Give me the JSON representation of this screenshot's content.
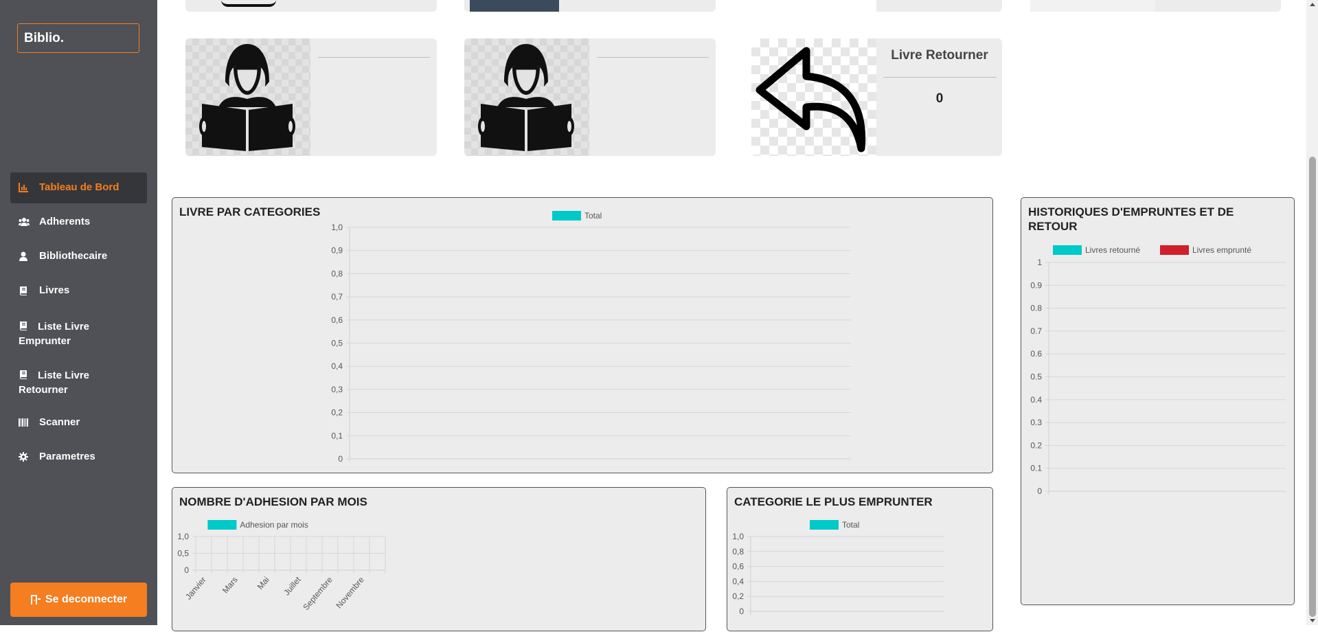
{
  "sidebar": {
    "brand": "Biblio.",
    "items": [
      {
        "label": "Tableau de Bord",
        "icon": "chart-icon",
        "active": true
      },
      {
        "label": "Adherents",
        "icon": "users-icon"
      },
      {
        "label": "Bibliothecaire",
        "icon": "user-icon"
      },
      {
        "label": "Livres",
        "icon": "book-icon"
      },
      {
        "label": "Liste Livre Emprunter",
        "icon": "book-icon"
      },
      {
        "label": "Liste Livre Retourner",
        "icon": "book-icon"
      },
      {
        "label": "Scanner",
        "icon": "barcode-icon"
      },
      {
        "label": "Parametres",
        "icon": "gear-icon"
      }
    ],
    "logout_label": "Se deconnecter"
  },
  "cards": {
    "returned_title": "Livre Retourner",
    "returned_value": "0"
  },
  "colors": {
    "accent": "#f47e20",
    "sidebar": "#4f5156",
    "teal": "#00c9c9",
    "red": "#d0202a"
  },
  "chart_data": [
    {
      "type": "bar",
      "title": "LIVRE PAR CATEGORIES",
      "categories": [],
      "series": [
        {
          "name": "Total",
          "values": []
        }
      ],
      "ylim": [
        0,
        1
      ],
      "yticks": [
        "1,0",
        "0,9",
        "0,8",
        "0,7",
        "0,6",
        "0,5",
        "0,4",
        "0,3",
        "0,2",
        "0,1",
        "0"
      ],
      "grid": true,
      "legend": "top"
    },
    {
      "type": "bar",
      "title": "HISTORIQUES D'EMPRUNTES ET DE RETOUR",
      "categories": [],
      "series": [
        {
          "name": "Livres retourné",
          "values": []
        },
        {
          "name": "Livres emprunté",
          "values": []
        }
      ],
      "ylim": [
        0,
        1
      ],
      "yticks": [
        "1",
        "0.9",
        "0.8",
        "0.7",
        "0.6",
        "0.5",
        "0.4",
        "0.3",
        "0.2",
        "0.1",
        "0"
      ],
      "grid": true,
      "legend": "top"
    },
    {
      "type": "bar",
      "title": "NOMBRE D'ADHESION PAR MOIS",
      "categories": [
        "Janvier",
        "Mars",
        "Mai",
        "Juillet",
        "Septembre",
        "Novembre"
      ],
      "series": [
        {
          "name": "Adhesion par mois",
          "values": []
        }
      ],
      "ylim": [
        0,
        1
      ],
      "yticks": [
        "1,0",
        "0,5",
        "0"
      ],
      "grid": true,
      "legend": "top"
    },
    {
      "type": "bar",
      "title": "CATEGORIE LE PLUS EMPRUNTER",
      "categories": [],
      "series": [
        {
          "name": "Total",
          "values": []
        }
      ],
      "ylim": [
        0,
        1
      ],
      "yticks": [
        "1,0",
        "0,8",
        "0,6",
        "0,4",
        "0,2",
        "0"
      ],
      "grid": true,
      "legend": "top"
    }
  ]
}
